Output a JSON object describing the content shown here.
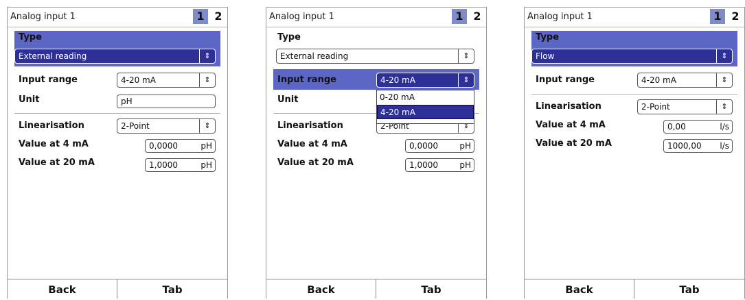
{
  "screens": [
    {
      "title": "Analog input 1",
      "tabs": [
        "1",
        "2"
      ],
      "type_label": "Type",
      "type_value": "External reading",
      "input_range_label": "Input range",
      "input_range_value": "4-20 mA",
      "unit_label": "Unit",
      "unit_value": "pH",
      "linearisation_label": "Linearisation",
      "linearisation_value": "2-Point",
      "value_4_label": "Value at 4 mA",
      "value_4": "0,0000",
      "value_4_unit": "pH",
      "value_20_label": "Value at 20 mA",
      "value_20": "1,0000",
      "value_20_unit": "pH",
      "back": "Back",
      "tab": "Tab"
    },
    {
      "title": "Analog input 1",
      "tabs": [
        "1",
        "2"
      ],
      "type_label": "Type",
      "type_value": "External reading",
      "input_range_label": "Input range",
      "input_range_value": "4-20 mA",
      "dropdown_options": [
        "0-20 mA",
        "4-20 mA"
      ],
      "unit_label": "Unit",
      "linearisation_label": "Linearisation",
      "linearisation_value": "2-Point",
      "value_4_label": "Value at 4 mA",
      "value_4": "0,0000",
      "value_4_unit": "pH",
      "value_20_label": "Value at 20 mA",
      "value_20": "1,0000",
      "value_20_unit": "pH",
      "back": "Back",
      "tab": "Tab"
    },
    {
      "title": "Analog input 1",
      "tabs": [
        "1",
        "2"
      ],
      "type_label": "Type",
      "type_value": "Flow",
      "input_range_label": "Input range",
      "input_range_value": "4-20 mA",
      "linearisation_label": "Linearisation",
      "linearisation_value": "2-Point",
      "value_4_label": "Value at 4 mA",
      "value_4": "0,00",
      "value_4_unit": "l/s",
      "value_20_label": "Value at 20 mA",
      "value_20": "1000,00",
      "value_20_unit": "l/s",
      "back": "Back",
      "tab": "Tab"
    }
  ],
  "icons": {
    "spinner": "up-down-arrows-icon"
  },
  "colors": {
    "highlight": "#5c66c4",
    "selected": "#2e3098",
    "tab_active": "#7f8cc9"
  }
}
